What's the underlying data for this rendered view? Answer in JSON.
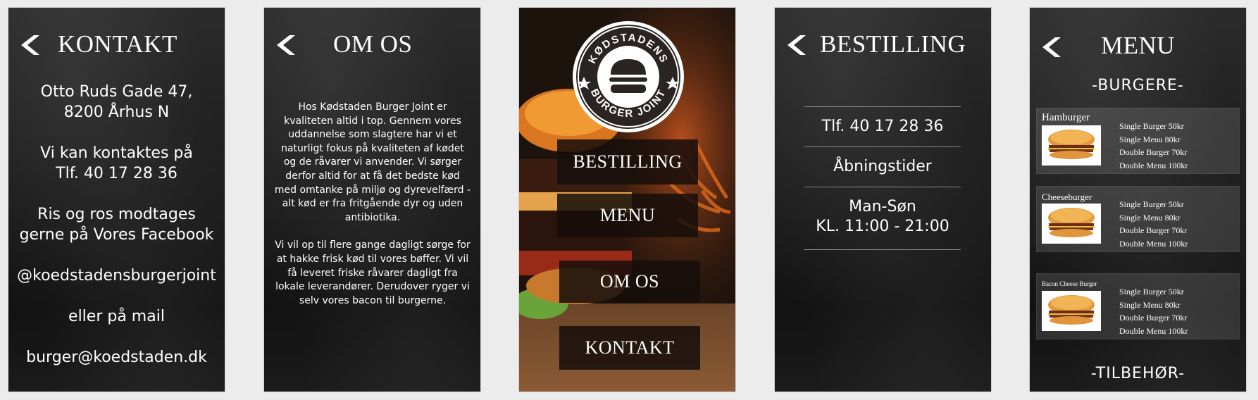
{
  "kontakt": {
    "title": "KONTAKT",
    "address_line1": "Otto Ruds Gade 47,",
    "address_line2": "8200 Århus N",
    "contact_line1": "Vi kan kontaktes på",
    "contact_line2": "Tlf. 40 17 28 36",
    "feedback_line1": "Ris og ros modtages",
    "feedback_line2": "gerne på Vores Facebook",
    "facebook_handle": "@koedstadensburgerjoint",
    "mail_intro": "eller på mail",
    "email": "burger@koedstaden.dk"
  },
  "om_os": {
    "title": "OM OS",
    "paragraph1": "Hos Kødstaden Burger Joint er kvaliteten altid i top. Gennem vores uddannelse som slagtere har vi et naturligt fokus på kvaliteten af kødet og de råvarer vi anvender. Vi sørger derfor altid for at få det bedste kød med omtanke på miljø og dyrevelfærd - alt kød er fra fritgående dyr og uden antibiotika.",
    "paragraph2": "Vi vil op til flere gange dagligt sørge for at hakke frisk kød til vores bøffer. Vi vil få leveret friske råvarer dagligt fra lokale leverandører. Derudover ryger vi selv vores bacon til burgerne."
  },
  "home": {
    "logo_top_text": "KØDSTADENS",
    "logo_bottom_text": "BURGER JOINT",
    "buttons": [
      "BESTILLING",
      "MENU",
      "OM OS",
      "KONTAKT"
    ]
  },
  "bestilling": {
    "title": "BESTILLING",
    "phone": "Tlf. 40 17 28 36",
    "hours_label": "Åbningstider",
    "days": "Man-Søn",
    "hours": "KL. 11:00 - 21:00"
  },
  "menu": {
    "title": "MENU",
    "section_burgers": "-BURGERE-",
    "section_sides": "-TILBEHØR-",
    "items": [
      {
        "name": "Hamburger",
        "prices": [
          "Single Burger  50kr",
          "Single Menu  80kr",
          "Double Burger  70kr",
          "Double Menu  100kr"
        ]
      },
      {
        "name": "Cheeseburger",
        "prices": [
          "Single Burger  50kr",
          "Single Menu  80kr",
          "Double Burger  70kr",
          "Double Menu  100kr"
        ]
      },
      {
        "name": "Bacon Cheese Burger",
        "prices": [
          "Single Burger  50kr",
          "Single Menu  80kr",
          "Double Burger  70kr",
          "Double Menu  100kr"
        ]
      }
    ]
  },
  "colors": {
    "panel_dark": "#1d1d1d",
    "button_bg": "#160e0a",
    "text": "#ffffff"
  }
}
